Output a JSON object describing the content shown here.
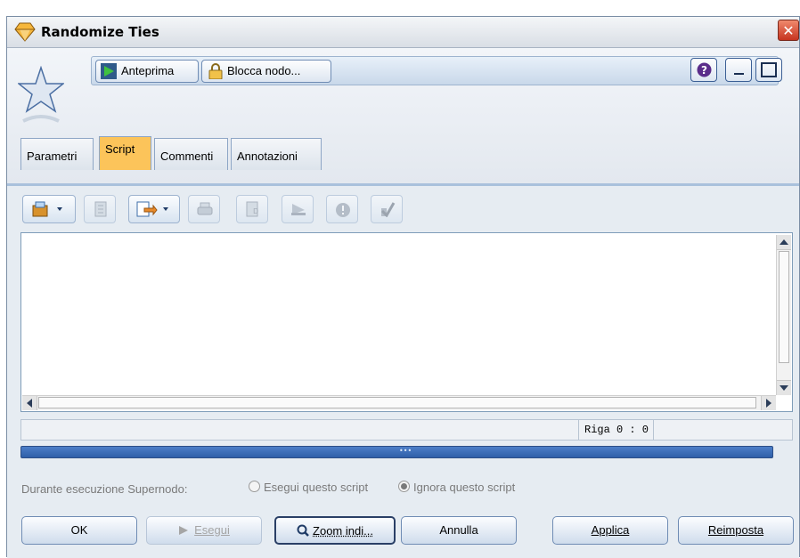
{
  "window": {
    "title": "Randomize Ties",
    "close_symbol": "✕"
  },
  "toolbar": {
    "preview_label": "Anteprima",
    "lock_label": "Blocca nodo...",
    "help_symbol": "?"
  },
  "tabs": [
    {
      "label": "Parametri",
      "active": false
    },
    {
      "label": "Script",
      "active": true
    },
    {
      "label": "Commenti",
      "active": false
    },
    {
      "label": "Annotazioni",
      "active": false
    }
  ],
  "script_toolbar": [
    {
      "icon": "import-script-icon",
      "enabled": true
    },
    {
      "icon": "script-page-icon",
      "enabled": false
    },
    {
      "icon": "export-script-icon",
      "enabled": true
    },
    {
      "icon": "print-icon",
      "enabled": false
    },
    {
      "icon": "text-doc-icon",
      "enabled": false
    },
    {
      "icon": "run-selection-icon",
      "enabled": false
    },
    {
      "icon": "stop-icon",
      "enabled": false
    },
    {
      "icon": "check-syntax-icon",
      "enabled": false
    }
  ],
  "editor": {
    "content": ""
  },
  "statusbar": {
    "cursor_position": "Riga 0 : 0"
  },
  "supernode": {
    "label": "Durante esecuzione Supernodo:",
    "options": [
      {
        "label": "Esegui questo script",
        "selected": false
      },
      {
        "label": "Ignora questo script",
        "selected": true
      }
    ]
  },
  "buttons": {
    "ok": "OK",
    "run": "Esegui",
    "zoom": "Zoom indi...",
    "cancel": "Annulla",
    "apply": "Applica",
    "reset": "Reimposta"
  },
  "colors": {
    "active_tab": "#fcc45a",
    "splitter": "#3b6fba",
    "close": "#d4482f"
  }
}
